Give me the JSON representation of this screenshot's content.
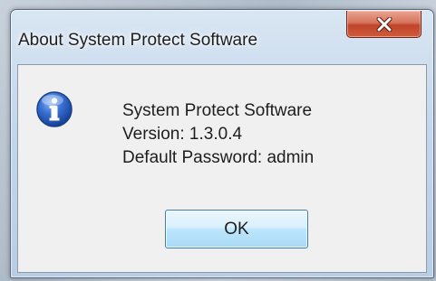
{
  "window": {
    "title": "About System Protect Software"
  },
  "message": {
    "line1": "System Protect Software",
    "line2": "Version: 1.3.0.4",
    "line3": "Default Password: admin"
  },
  "buttons": {
    "ok_label": "OK"
  },
  "icons": {
    "dialog_icon": "information-icon",
    "close_icon": "close-icon"
  },
  "colors": {
    "close_button": "#c7503a",
    "ok_button_border": "#3c7fb1",
    "info_icon": "#2b5fbf"
  }
}
